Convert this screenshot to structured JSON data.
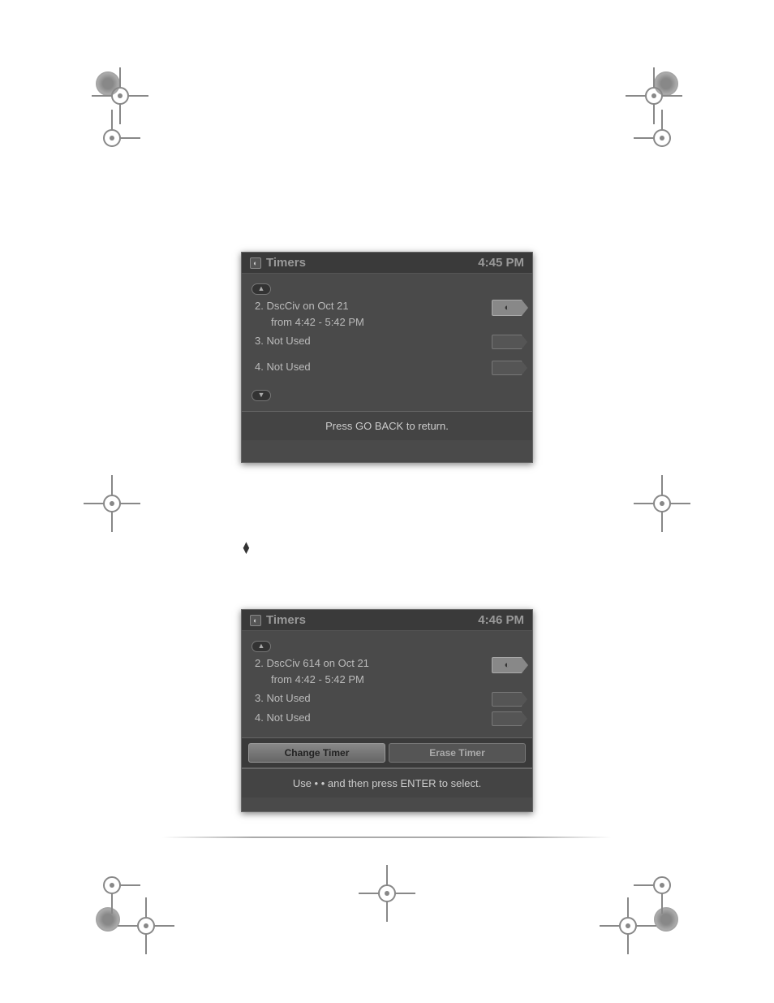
{
  "panel1": {
    "title": "Timers",
    "time": "4:45 PM",
    "items": [
      {
        "idx": "2.",
        "line1": "DscCiv on Oct 21",
        "line2": "from 4:42 - 5:42 PM",
        "hasIcon": true
      },
      {
        "idx": "3.",
        "line1": "Not Used",
        "line2": "",
        "hasIcon": false
      },
      {
        "idx": "4.",
        "line1": "Not Used",
        "line2": "",
        "hasIcon": false
      }
    ],
    "footer": "Press GO BACK to return."
  },
  "mid": {
    "text_prefix": "",
    "icon": "▲▼"
  },
  "panel2": {
    "title": "Timers",
    "time": "4:46 PM",
    "items": [
      {
        "idx": "2.",
        "line1": "DscCiv 614 on Oct 21",
        "line2": "from 4:42 - 5:42 PM",
        "hasIcon": true
      },
      {
        "idx": "3.",
        "line1": "Not Used",
        "line2": "",
        "hasIcon": false
      },
      {
        "idx": "4.",
        "line1": "Not Used",
        "line2": "",
        "hasIcon": false
      }
    ],
    "buttons": {
      "change": "Change Timer",
      "erase": "Erase Timer"
    },
    "footer": "Use • • and then press ENTER to select."
  }
}
